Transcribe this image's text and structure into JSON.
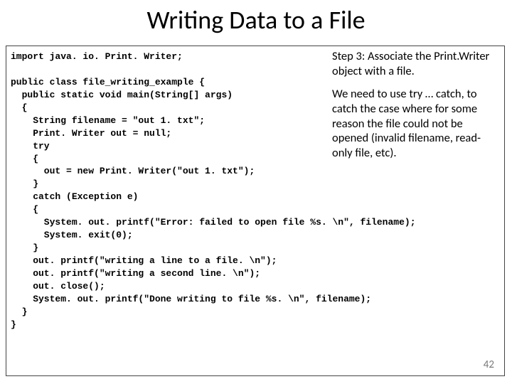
{
  "title": "Writing Data to a File",
  "code": "import java. io. Print. Writer;\n\npublic class file_writing_example {\n  public static void main(String[] args)\n  {\n    String filename = \"out 1. txt\";\n    Print. Writer out = null;\n    try\n    {\n      out = new Print. Writer(\"out 1. txt\");\n    }\n    catch (Exception e)\n    {\n      System. out. printf(\"Error: failed to open file %s. \\n\", filename);\n      System. exit(0);\n    }\n    out. printf(\"writing a line to a file. \\n\");\n    out. printf(\"writing a second line. \\n\");\n    out. close();\n    System. out. printf(\"Done writing to file %s. \\n\", filename);\n  }\n}",
  "note": {
    "p1": "Step 3: Associate the Print.Writer object with a file.",
    "p2": "We need to use try … catch, to catch the case where for some reason the file could not be opened (invalid filename, read-only file, etc)."
  },
  "page": "42"
}
